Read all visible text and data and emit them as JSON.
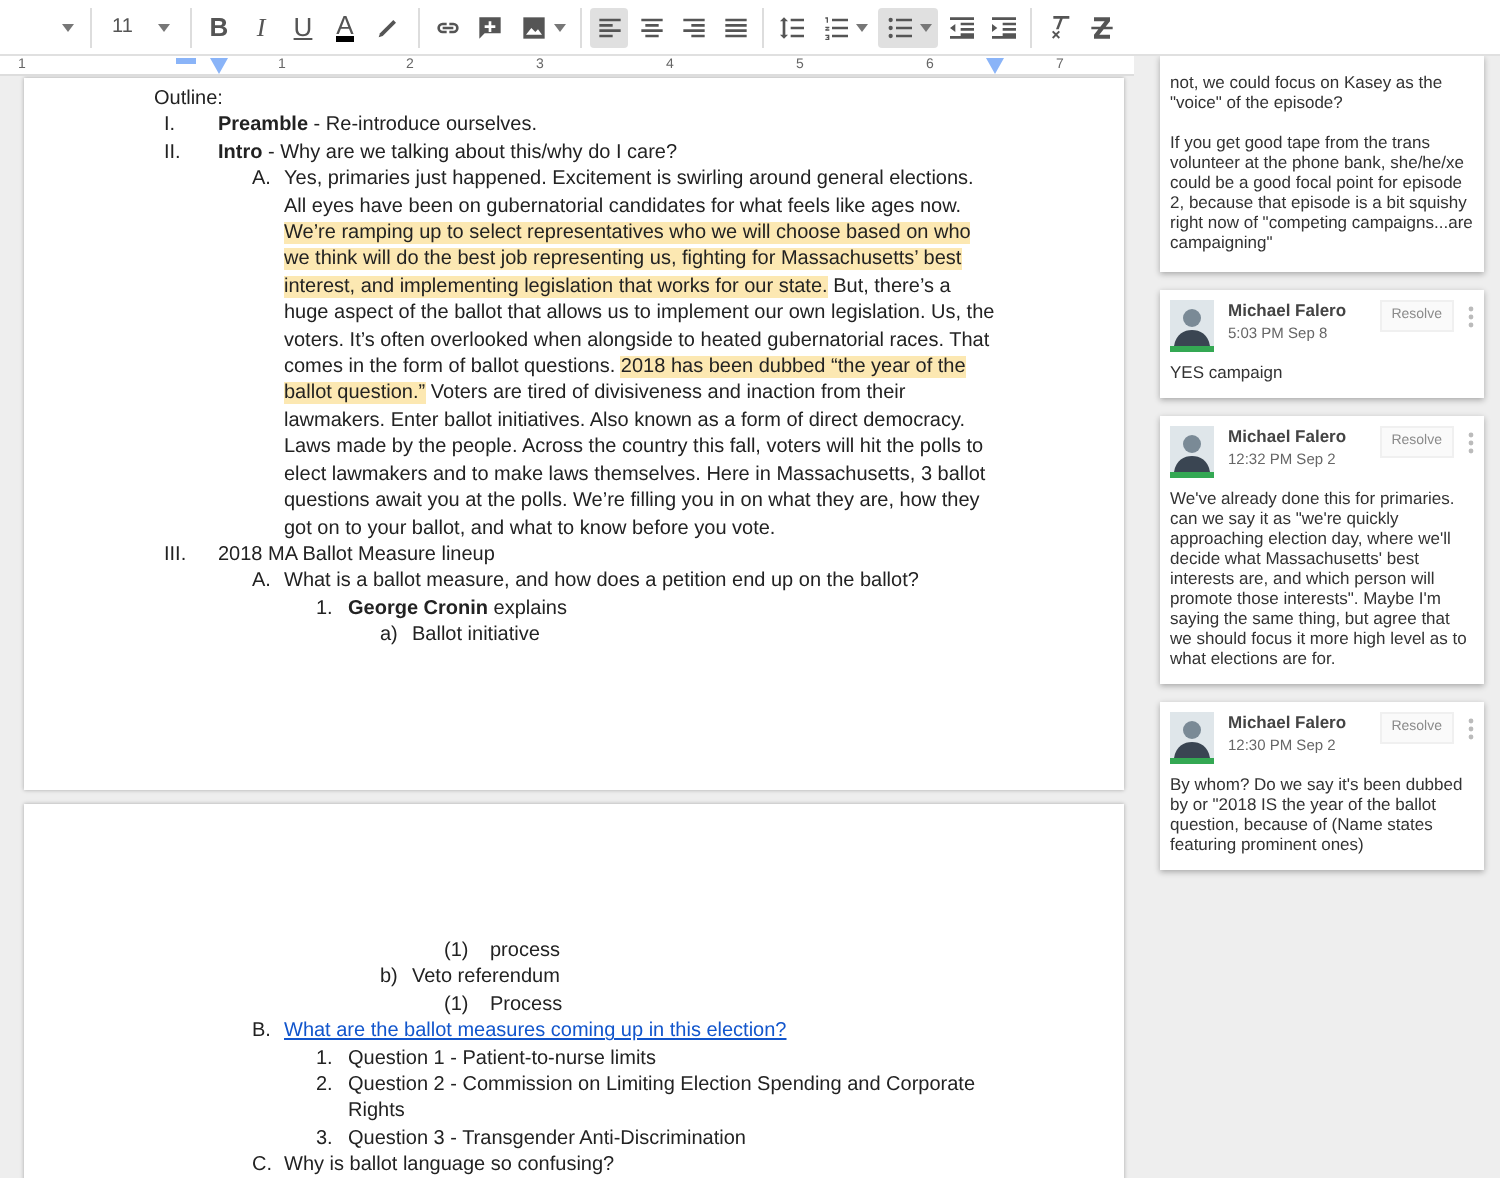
{
  "toolbar": {
    "font_size": "11",
    "items": [
      {
        "kind": "bold",
        "label": "B",
        "selected": false
      },
      {
        "kind": "italic",
        "label": "I",
        "selected": false
      },
      {
        "kind": "underline",
        "label": "U",
        "selected": false
      },
      {
        "kind": "text_color",
        "label": "A",
        "selected": false
      },
      {
        "kind": "highlight",
        "selected": false
      },
      {
        "kind": "sep"
      },
      {
        "kind": "link",
        "selected": false
      },
      {
        "kind": "comment",
        "selected": false
      },
      {
        "kind": "image",
        "selected": false
      },
      {
        "kind": "sep"
      },
      {
        "kind": "align_left",
        "selected": true
      },
      {
        "kind": "align_center",
        "selected": false
      },
      {
        "kind": "align_right",
        "selected": false
      },
      {
        "kind": "align_justify",
        "selected": false
      },
      {
        "kind": "sep"
      },
      {
        "kind": "line_spacing",
        "selected": false
      },
      {
        "kind": "numbered_list",
        "selected": false
      },
      {
        "kind": "bulleted_list",
        "selected": true
      },
      {
        "kind": "indent_less",
        "selected": false
      },
      {
        "kind": "indent_more",
        "selected": false
      },
      {
        "kind": "sep"
      },
      {
        "kind": "clear_format",
        "selected": false
      },
      {
        "kind": "strike_z",
        "selected": false
      }
    ]
  },
  "ruler": {
    "labels": [
      "1",
      "1",
      "2",
      "3",
      "4",
      "5",
      "6",
      "7"
    ]
  },
  "page_1": {
    "heading": "Outline:",
    "items": [
      {
        "marker": "I.",
        "text": "**Preamble** - Re-introduce ourselves."
      },
      {
        "marker": "II.",
        "text": "**Intro** - Why are we talking about this/why do I care?",
        "children": [
          {
            "marker": "A.",
            "segments": [
              {
                "text": "Yes, primaries just happened. Excitement is swirling around general elections. All eyes have been on gubernatorial candidates for what feels like ages now. ",
                "highlighted": false
              },
              {
                "text": "We’re ramping up to select representatives who we will choose based on who we think will do the best job representing us, fighting for Massachusetts’ best interest, and implementing legislation that works for our state.",
                "highlighted": true
              },
              {
                "text": " But, there’s a huge aspect of the ballot that allows us to implement our own legislation. Us, the voters. It’s often overlooked when alongside to heated gubernatorial races. That comes in the form of ballot questions. ",
                "highlighted": false
              },
              {
                "text": "2018 has been dubbed “the year of the ballot question.”",
                "highlighted": true
              },
              {
                "text": " Voters are tired of divisiveness and inaction from their lawmakers. Enter ballot initiatives. Also known as a form of direct democracy. Laws made by the people. Across the country this fall, voters will hit the polls to elect lawmakers and to make laws themselves. Here in Massachusetts, 3 ballot questions await you at the polls. We’re filling you in on what they are, how they got on to your ballot, and what to know before you vote.",
                "highlighted": false
              }
            ]
          }
        ]
      },
      {
        "marker": "III.",
        "text": "2018 MA Ballot Measure lineup",
        "children": [
          {
            "marker": "A.",
            "text": "What is a ballot measure, and how does a petition end up on the ballot?",
            "children": [
              {
                "marker": "1.",
                "text": "**George Cronin** explains",
                "children": [
                  {
                    "marker": "a)",
                    "text": "Ballot initiative"
                  }
                ]
              }
            ]
          }
        ]
      }
    ]
  },
  "page_2": {
    "items": [
      {
        "children": [
          {
            "children": [
              {
                "children": [
                  {
                    "children": [
                      {
                        "marker": "(1)",
                        "text": "process"
                      }
                    ]
                  },
                  {
                    "marker": "b)",
                    "text": "Veto referendum",
                    "children": [
                      {
                        "marker": "(1)",
                        "text": "Process"
                      }
                    ]
                  }
                ]
              }
            ]
          },
          {
            "marker": "B.",
            "text": "What are the ballot measures coming up in this election?",
            "kind": "link",
            "children": [
              {
                "marker": "1.",
                "text": "Question 1 - Patient-to-nurse limits"
              },
              {
                "marker": "2.",
                "text": "Question 2 - Commission on Limiting Election Spending and Corporate Rights"
              },
              {
                "marker": "3.",
                "text": "Question 3 - Transgender Anti-Discrimination"
              }
            ]
          },
          {
            "marker": "C.",
            "text": "Why is ballot language so confusing?"
          }
        ]
      }
    ]
  },
  "comments": [
    {
      "paragraphs": [
        "not, we could focus on Kasey as the \"voice\" of the episode?",
        "If you get good tape from the trans volunteer at the phone bank, she/he/xe could be a good focal point for episode 2, because that episode is a bit squishy right now of \"competing campaigns...are campaigning\""
      ]
    },
    {
      "author": "Michael Falero",
      "time": "5:03 PM Sep 8",
      "resolve": "Resolve",
      "paragraphs": [
        "YES campaign"
      ]
    },
    {
      "author": "Michael Falero",
      "time": "12:32 PM Sep 2",
      "resolve": "Resolve",
      "paragraphs": [
        "We've already done this for primaries. can we say it as \"we're quickly approaching election day, where we'll decide what Massachusetts' best interests are, and which person will promote those interests\". Maybe I'm saying the same thing, but agree that we should focus it more high level as to what elections are for."
      ]
    },
    {
      "author": "Michael Falero",
      "time": "12:30 PM Sep 2",
      "resolve": "Resolve",
      "paragraphs": [
        "By whom? Do we say it's been dubbed by or \"2018 IS the year of the ballot question, because of (Name states featuring prominent ones)"
      ]
    }
  ]
}
